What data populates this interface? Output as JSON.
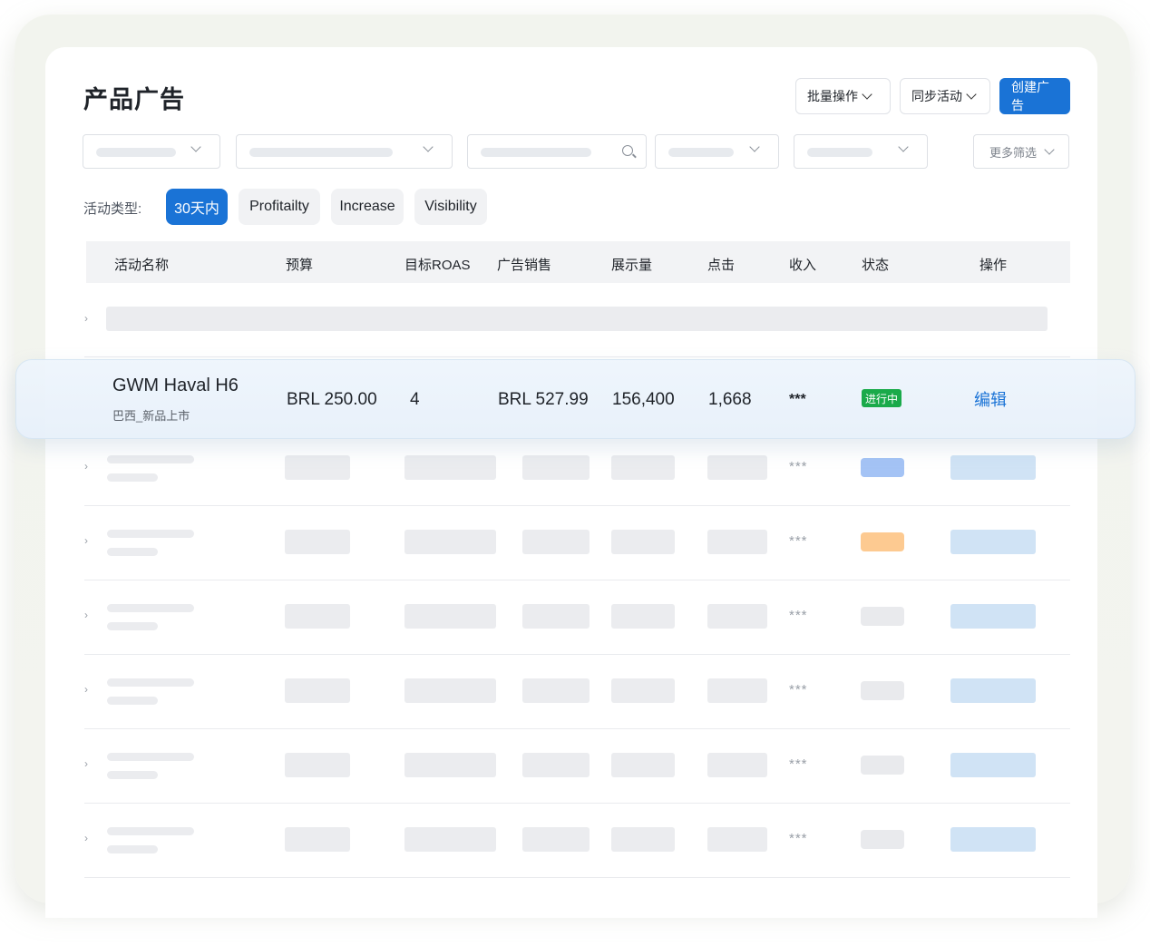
{
  "page": {
    "title": "产品广告"
  },
  "toolbar": {
    "bulk_ops": "批量操作",
    "sync": "同步活动",
    "create": "创建广告"
  },
  "filters": {
    "more": "更多筛选"
  },
  "campaign_type": {
    "label": "活动类型:",
    "options": [
      "30天内",
      "Profitailty",
      "Increase",
      "Visibility"
    ],
    "selected": "30天内"
  },
  "table": {
    "headers": [
      "活动名称",
      "预算",
      "目标ROAS",
      "广告销售",
      "展示量",
      "点击",
      "收入",
      "状态",
      "操作"
    ],
    "highlighted_row": {
      "name": "GWM Haval H6",
      "sub": "巴西_新品上市",
      "budget": "BRL 250.00",
      "target_roas": "4",
      "ad_sales": "BRL 527.99",
      "impressions": "156,400",
      "clicks": "1,668",
      "revenue": "***",
      "status": "进行中",
      "action": "编辑"
    },
    "masked_revenue": [
      "***",
      "***",
      "***",
      "***",
      "***",
      "***"
    ]
  },
  "colors": {
    "primary": "#1a73d6",
    "status_running": "#1aaa4a",
    "placeholder_blue": "#a4c3f5",
    "placeholder_orange": "#fdca91",
    "placeholder_action": "#d0e3f5"
  }
}
